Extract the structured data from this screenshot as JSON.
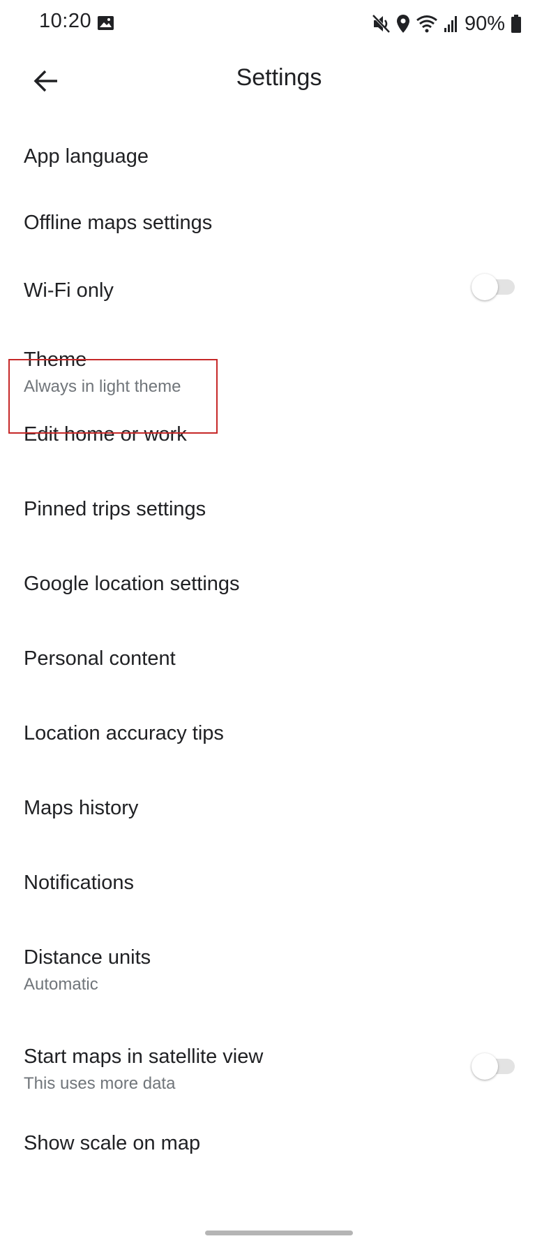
{
  "status_bar": {
    "time": "10:20",
    "battery": "90%",
    "icons": [
      "gallery-icon",
      "mute-icon",
      "location-pin-icon",
      "wifi-icon",
      "signal-icon",
      "battery-icon"
    ]
  },
  "app_bar": {
    "title": "Settings",
    "back_icon": "arrow-back-icon"
  },
  "settings": {
    "app_language": {
      "label": "App language"
    },
    "offline_maps": {
      "label": "Offline maps settings"
    },
    "wifi_only": {
      "label": "Wi-Fi only",
      "toggle_on": false
    },
    "theme": {
      "label": "Theme",
      "sub": "Always in light theme",
      "highlight_color": "#c62828"
    },
    "edit_home_work": {
      "label": "Edit home or work"
    },
    "pinned_trips": {
      "label": "Pinned trips settings"
    },
    "google_location": {
      "label": "Google location settings"
    },
    "personal_content": {
      "label": "Personal content"
    },
    "location_accuracy": {
      "label": "Location accuracy tips"
    },
    "maps_history": {
      "label": "Maps history"
    },
    "notifications": {
      "label": "Notifications"
    },
    "distance_units": {
      "label": "Distance units",
      "sub": "Automatic"
    },
    "satellite_view": {
      "label": "Start maps in satellite view",
      "sub": "This uses more data",
      "toggle_on": false
    },
    "show_scale": {
      "label": "Show scale on map"
    }
  },
  "colors": {
    "text_primary": "#202124",
    "text_secondary": "#70757a",
    "toggle_track_off": "#e3e3e3",
    "highlight": "#c62828"
  }
}
